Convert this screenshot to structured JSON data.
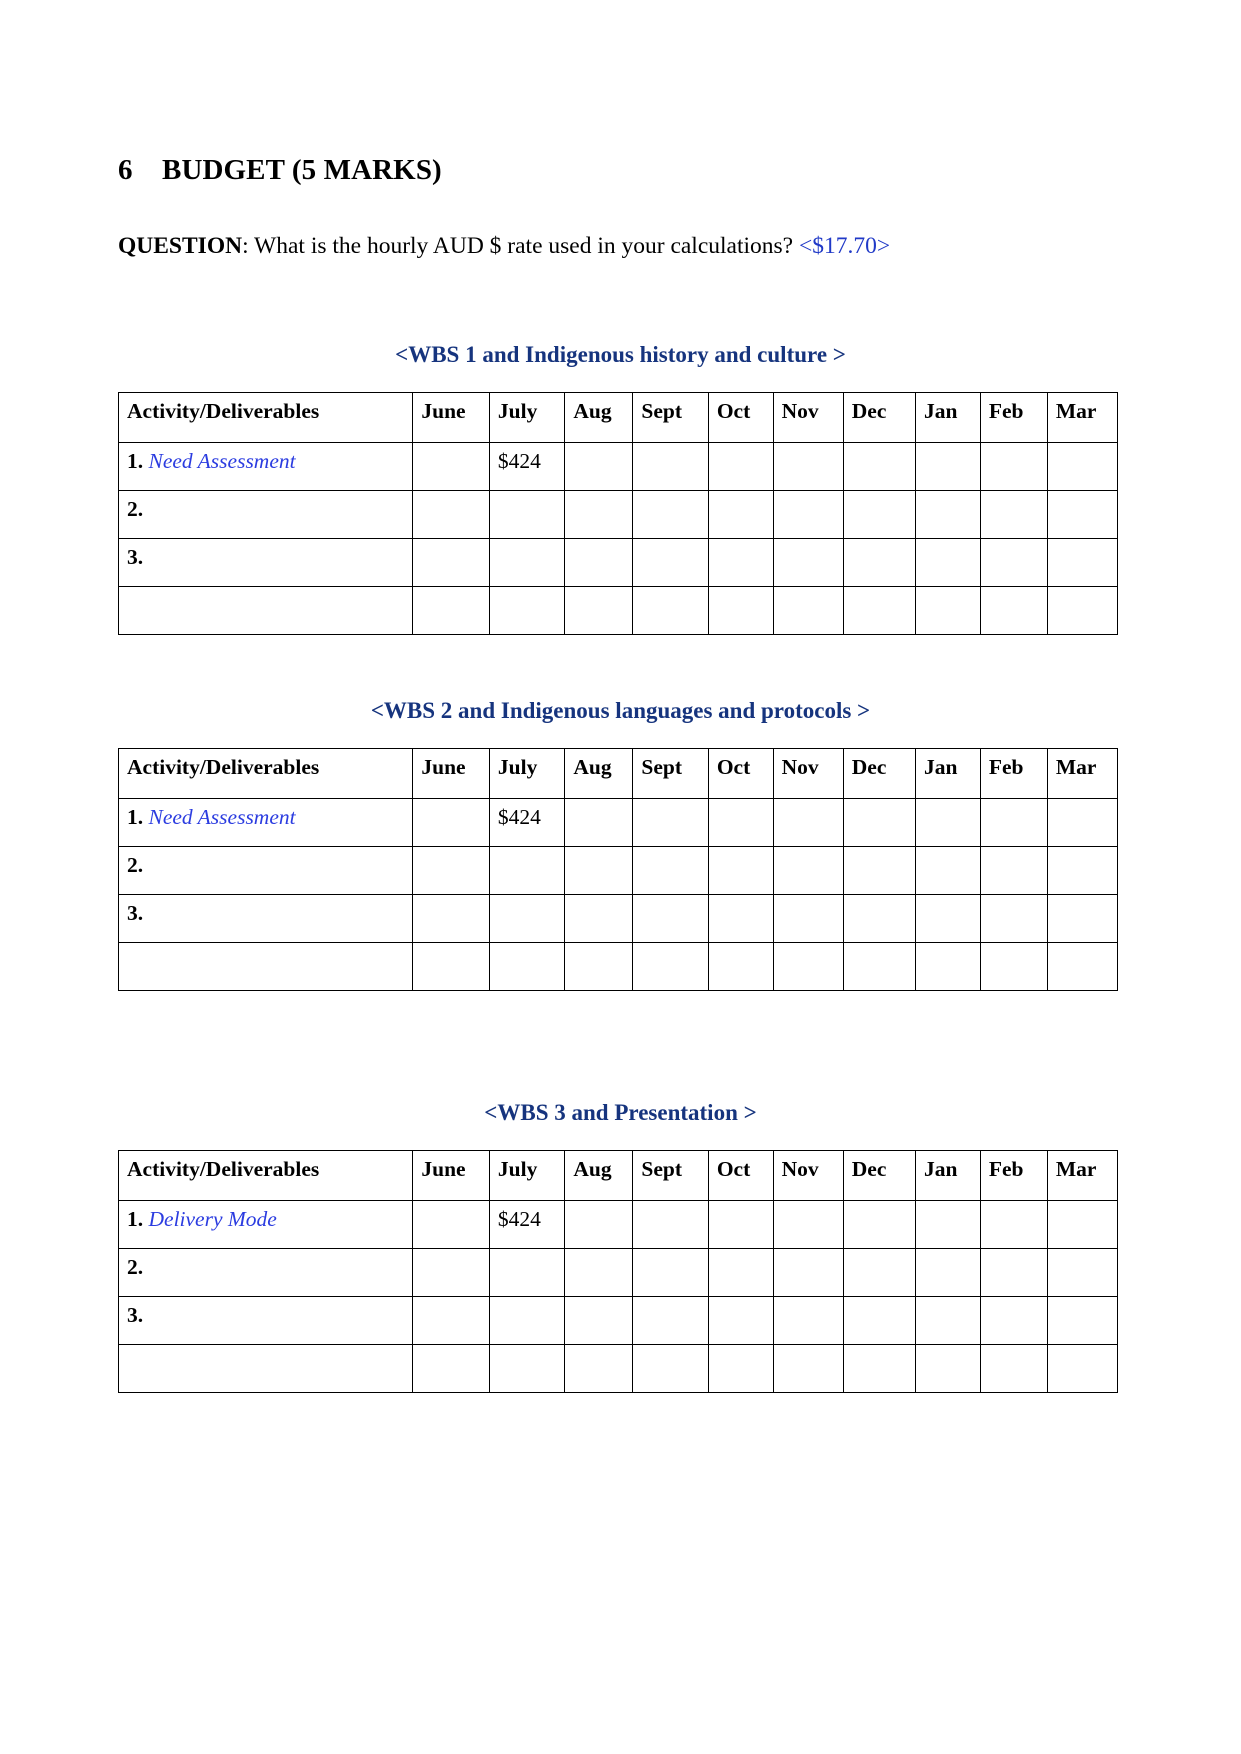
{
  "document": {
    "section_number": "6",
    "section_title": "BUDGET (5 MARKS)",
    "question_label": "QUESTION",
    "question_text": ": What is the hourly AUD $ rate used in your calculations? ",
    "question_answer": "<$17.70>",
    "colors": {
      "answer_blue": "#2039c7",
      "heading_blue": "#16347e",
      "activity_blue": "#2b3ce0",
      "text_black": "#000000",
      "border_black": "#000000"
    }
  },
  "columns": [
    "Activity/Deliverables",
    "June",
    "July",
    "Aug",
    "Sept",
    "Oct",
    "Nov",
    "Dec",
    "Jan",
    "Feb",
    "Mar"
  ],
  "tables": [
    {
      "title": "<WBS 1 and Indigenous history and culture >",
      "rows": [
        {
          "number": "1.",
          "activity": "Need Assessment",
          "values": [
            "",
            "$424",
            "",
            "",
            "",
            "",
            "",
            "",
            "",
            ""
          ]
        },
        {
          "number": "2.",
          "activity": "",
          "values": [
            "",
            "",
            "",
            "",
            "",
            "",
            "",
            "",
            "",
            ""
          ]
        },
        {
          "number": "3.",
          "activity": "",
          "values": [
            "",
            "",
            "",
            "",
            "",
            "",
            "",
            "",
            "",
            ""
          ]
        },
        {
          "number": "",
          "activity": "",
          "values": [
            "",
            "",
            "",
            "",
            "",
            "",
            "",
            "",
            "",
            ""
          ]
        }
      ]
    },
    {
      "title": "<WBS 2 and Indigenous languages and protocols >",
      "rows": [
        {
          "number": "1.",
          "activity": "Need Assessment",
          "values": [
            "",
            "$424",
            "",
            "",
            "",
            "",
            "",
            "",
            "",
            ""
          ]
        },
        {
          "number": "2.",
          "activity": "",
          "values": [
            "",
            "",
            "",
            "",
            "",
            "",
            "",
            "",
            "",
            ""
          ]
        },
        {
          "number": "3.",
          "activity": "",
          "values": [
            "",
            "",
            "",
            "",
            "",
            "",
            "",
            "",
            "",
            ""
          ]
        },
        {
          "number": "",
          "activity": "",
          "values": [
            "",
            "",
            "",
            "",
            "",
            "",
            "",
            "",
            "",
            ""
          ]
        }
      ]
    },
    {
      "title": "<WBS 3 and Presentation >",
      "rows": [
        {
          "number": "1.",
          "activity": "Delivery Mode",
          "values": [
            "",
            "$424",
            "",
            "",
            "",
            "",
            "",
            "",
            "",
            ""
          ]
        },
        {
          "number": "2.",
          "activity": "",
          "values": [
            "",
            "",
            "",
            "",
            "",
            "",
            "",
            "",
            "",
            ""
          ]
        },
        {
          "number": "3.",
          "activity": "",
          "values": [
            "",
            "",
            "",
            "",
            "",
            "",
            "",
            "",
            "",
            ""
          ]
        },
        {
          "number": "",
          "activity": "",
          "values": [
            "",
            "",
            "",
            "",
            "",
            "",
            "",
            "",
            "",
            ""
          ]
        }
      ]
    }
  ]
}
